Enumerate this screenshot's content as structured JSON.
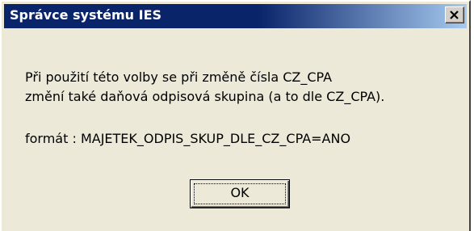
{
  "window": {
    "title": "Správce systému IES"
  },
  "message": {
    "line1": "Při použití této volby se při změně čísla CZ_CPA",
    "line2": "změní také daňová odpisová skupina (a to dle CZ_CPA).",
    "format": "formát : MAJETEK_ODPIS_SKUP_DLE_CZ_CPA=ANO"
  },
  "buttons": {
    "ok_label": "OK",
    "close_icon": "close-icon"
  },
  "colors": {
    "titlebar_start": "#0a246a",
    "titlebar_end": "#a6caf0",
    "dialog_background": "#ece9d8"
  }
}
